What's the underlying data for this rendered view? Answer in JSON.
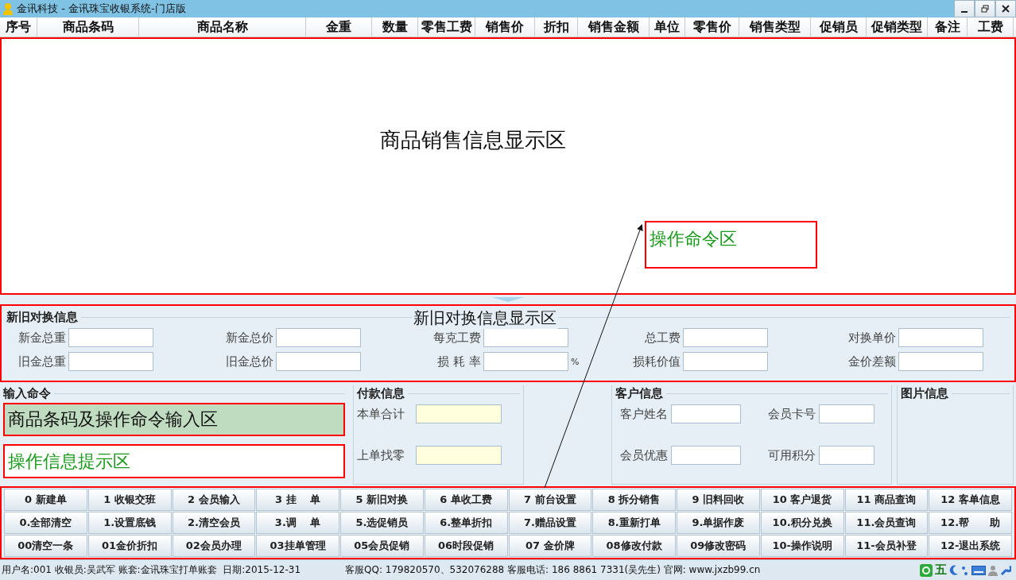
{
  "window": {
    "title": "金讯科技 - 金讯珠宝收银系统-门店版"
  },
  "table": {
    "columns": [
      {
        "label": "序号"
      },
      {
        "label": "商品条码"
      },
      {
        "label": "商品名称"
      },
      {
        "label": "金重"
      },
      {
        "label": "数量"
      },
      {
        "label": "零售工费"
      },
      {
        "label": "销售价"
      },
      {
        "label": "折扣"
      },
      {
        "label": "销售金额"
      },
      {
        "label": "单位"
      },
      {
        "label": "零售价"
      },
      {
        "label": "销售类型"
      },
      {
        "label": "促销员"
      },
      {
        "label": "促销类型"
      },
      {
        "label": "备注"
      },
      {
        "label": "工费"
      }
    ],
    "area_label": "商品销售信息显示区"
  },
  "command_annotation": "操作命令区",
  "exchange": {
    "title": "新旧对换信息",
    "area_label": "新旧对换信息显示区",
    "fields": [
      {
        "label": "新金总重"
      },
      {
        "label": "新金总价"
      },
      {
        "label": "每克工费"
      },
      {
        "label": "总工费"
      },
      {
        "label": "对换单价"
      },
      {
        "label": "旧金总重"
      },
      {
        "label": "旧金总价"
      },
      {
        "label": "损 耗 率",
        "suffix": "%"
      },
      {
        "label": "损耗价值"
      },
      {
        "label": "金价差额"
      }
    ]
  },
  "input_command": {
    "title": "输入命令",
    "command_value": "商品条码及操作命令输入区",
    "message": "操作信息提示区"
  },
  "payment": {
    "title": "付款信息",
    "fields": [
      {
        "label": "本单合计"
      },
      {
        "label": "上单找零"
      }
    ]
  },
  "customer": {
    "title": "客户信息",
    "fields": [
      {
        "label": "客户姓名"
      },
      {
        "label": "会员卡号"
      },
      {
        "label": "会员优惠"
      },
      {
        "label": "可用积分"
      }
    ]
  },
  "picture": {
    "title": "图片信息"
  },
  "commands": [
    [
      "0 新建单",
      "1 收银交班",
      "2 会员输入",
      "3 挂　 单",
      "5 新旧对换",
      "6 单收工费",
      "7 前台设置",
      "8 拆分销售",
      "9 旧料回收",
      "10 客户退货",
      "11 商品查询",
      "12 客单信息"
    ],
    [
      "0.全部清空",
      "1.设置底钱",
      "2.清空会员",
      "3.调　 单",
      "5.选促销员",
      "6.整单折扣",
      "7.赠品设置",
      "8.重新打单",
      "9.单据作废",
      "10.积分兑换",
      "11.会员查询",
      "12.帮　　助"
    ],
    [
      "00清空一条",
      "01金价折扣",
      "02会员办理",
      "03挂单管理",
      "05会员促销",
      "06时段促销",
      "07 金价牌",
      "08修改付款",
      "09修改密码",
      "10-操作说明",
      "11-会员补登",
      "12-退出系统"
    ]
  ],
  "status_bar": {
    "left": "用户名:001 收银员:吴武军 账套:金讯珠宝打单账套  日期:2015-12-31",
    "right": "客服QQ: 179820570、532076288 客服电话: 186 8861 7331(吴先生) 官网: www.jxzb99.cn",
    "ime_label": "五"
  }
}
